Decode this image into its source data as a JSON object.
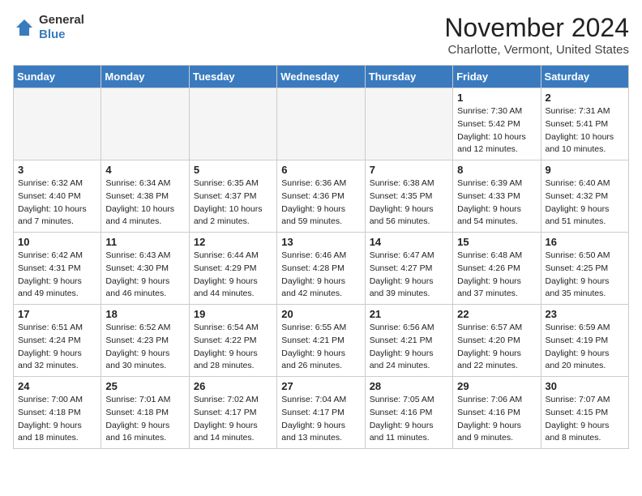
{
  "header": {
    "logo_line1": "General",
    "logo_line2": "Blue",
    "month_title": "November 2024",
    "location": "Charlotte, Vermont, United States"
  },
  "days_of_week": [
    "Sunday",
    "Monday",
    "Tuesday",
    "Wednesday",
    "Thursday",
    "Friday",
    "Saturday"
  ],
  "weeks": [
    [
      {
        "day": "",
        "info": ""
      },
      {
        "day": "",
        "info": ""
      },
      {
        "day": "",
        "info": ""
      },
      {
        "day": "",
        "info": ""
      },
      {
        "day": "",
        "info": ""
      },
      {
        "day": "1",
        "info": "Sunrise: 7:30 AM\nSunset: 5:42 PM\nDaylight: 10 hours and 12 minutes."
      },
      {
        "day": "2",
        "info": "Sunrise: 7:31 AM\nSunset: 5:41 PM\nDaylight: 10 hours and 10 minutes."
      }
    ],
    [
      {
        "day": "3",
        "info": "Sunrise: 6:32 AM\nSunset: 4:40 PM\nDaylight: 10 hours and 7 minutes."
      },
      {
        "day": "4",
        "info": "Sunrise: 6:34 AM\nSunset: 4:38 PM\nDaylight: 10 hours and 4 minutes."
      },
      {
        "day": "5",
        "info": "Sunrise: 6:35 AM\nSunset: 4:37 PM\nDaylight: 10 hours and 2 minutes."
      },
      {
        "day": "6",
        "info": "Sunrise: 6:36 AM\nSunset: 4:36 PM\nDaylight: 9 hours and 59 minutes."
      },
      {
        "day": "7",
        "info": "Sunrise: 6:38 AM\nSunset: 4:35 PM\nDaylight: 9 hours and 56 minutes."
      },
      {
        "day": "8",
        "info": "Sunrise: 6:39 AM\nSunset: 4:33 PM\nDaylight: 9 hours and 54 minutes."
      },
      {
        "day": "9",
        "info": "Sunrise: 6:40 AM\nSunset: 4:32 PM\nDaylight: 9 hours and 51 minutes."
      }
    ],
    [
      {
        "day": "10",
        "info": "Sunrise: 6:42 AM\nSunset: 4:31 PM\nDaylight: 9 hours and 49 minutes."
      },
      {
        "day": "11",
        "info": "Sunrise: 6:43 AM\nSunset: 4:30 PM\nDaylight: 9 hours and 46 minutes."
      },
      {
        "day": "12",
        "info": "Sunrise: 6:44 AM\nSunset: 4:29 PM\nDaylight: 9 hours and 44 minutes."
      },
      {
        "day": "13",
        "info": "Sunrise: 6:46 AM\nSunset: 4:28 PM\nDaylight: 9 hours and 42 minutes."
      },
      {
        "day": "14",
        "info": "Sunrise: 6:47 AM\nSunset: 4:27 PM\nDaylight: 9 hours and 39 minutes."
      },
      {
        "day": "15",
        "info": "Sunrise: 6:48 AM\nSunset: 4:26 PM\nDaylight: 9 hours and 37 minutes."
      },
      {
        "day": "16",
        "info": "Sunrise: 6:50 AM\nSunset: 4:25 PM\nDaylight: 9 hours and 35 minutes."
      }
    ],
    [
      {
        "day": "17",
        "info": "Sunrise: 6:51 AM\nSunset: 4:24 PM\nDaylight: 9 hours and 32 minutes."
      },
      {
        "day": "18",
        "info": "Sunrise: 6:52 AM\nSunset: 4:23 PM\nDaylight: 9 hours and 30 minutes."
      },
      {
        "day": "19",
        "info": "Sunrise: 6:54 AM\nSunset: 4:22 PM\nDaylight: 9 hours and 28 minutes."
      },
      {
        "day": "20",
        "info": "Sunrise: 6:55 AM\nSunset: 4:21 PM\nDaylight: 9 hours and 26 minutes."
      },
      {
        "day": "21",
        "info": "Sunrise: 6:56 AM\nSunset: 4:21 PM\nDaylight: 9 hours and 24 minutes."
      },
      {
        "day": "22",
        "info": "Sunrise: 6:57 AM\nSunset: 4:20 PM\nDaylight: 9 hours and 22 minutes."
      },
      {
        "day": "23",
        "info": "Sunrise: 6:59 AM\nSunset: 4:19 PM\nDaylight: 9 hours and 20 minutes."
      }
    ],
    [
      {
        "day": "24",
        "info": "Sunrise: 7:00 AM\nSunset: 4:18 PM\nDaylight: 9 hours and 18 minutes."
      },
      {
        "day": "25",
        "info": "Sunrise: 7:01 AM\nSunset: 4:18 PM\nDaylight: 9 hours and 16 minutes."
      },
      {
        "day": "26",
        "info": "Sunrise: 7:02 AM\nSunset: 4:17 PM\nDaylight: 9 hours and 14 minutes."
      },
      {
        "day": "27",
        "info": "Sunrise: 7:04 AM\nSunset: 4:17 PM\nDaylight: 9 hours and 13 minutes."
      },
      {
        "day": "28",
        "info": "Sunrise: 7:05 AM\nSunset: 4:16 PM\nDaylight: 9 hours and 11 minutes."
      },
      {
        "day": "29",
        "info": "Sunrise: 7:06 AM\nSunset: 4:16 PM\nDaylight: 9 hours and 9 minutes."
      },
      {
        "day": "30",
        "info": "Sunrise: 7:07 AM\nSunset: 4:15 PM\nDaylight: 9 hours and 8 minutes."
      }
    ]
  ]
}
